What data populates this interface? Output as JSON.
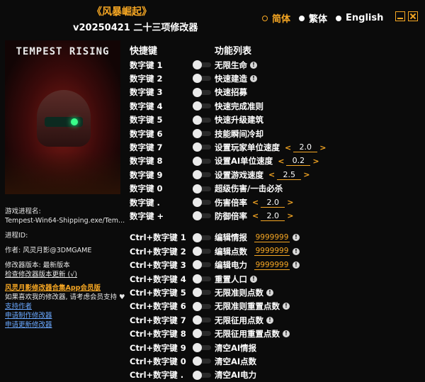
{
  "header": {
    "title": "《风暴崛起》",
    "version": "v20250421 二十三项修改器",
    "languages": [
      {
        "label": "简体",
        "selected": true
      },
      {
        "label": "繁体",
        "selected": false
      },
      {
        "label": "English",
        "selected": false
      }
    ]
  },
  "cover": {
    "logo_text": "TEMPEST RISING"
  },
  "info": {
    "process_label": "游戏进程名:",
    "process_value": "Tempest-Win64-Shipping.exe/Tem...",
    "pid_label": "进程ID:",
    "author": "作者: 风灵月影@3DMGAME",
    "trainer_version": "修改器版本: 最新版本",
    "check_update": "检查修改器版本更新 (√)",
    "app_link": "风灵月影修改器合集App会员版",
    "support_text": "如果喜欢我的修改器, 请考虑会员支持 ♥",
    "support_author": "支持作者",
    "request_trainer": "申请制作修改器",
    "request_update": "申请更新修改器"
  },
  "columns": {
    "hotkey": "快捷键",
    "features": "功能列表"
  },
  "rows_top": [
    {
      "key": "数字键 1",
      "label": "无限生命",
      "excl": true
    },
    {
      "key": "数字键 2",
      "label": "快速建造",
      "excl": true
    },
    {
      "key": "数字键 3",
      "label": "快速招募"
    },
    {
      "key": "数字键 4",
      "label": "快速完成准则"
    },
    {
      "key": "数字键 5",
      "label": "快速升级建筑"
    },
    {
      "key": "数字键 6",
      "label": "技能瞬间冷却"
    },
    {
      "key": "数字键 7",
      "label": "设置玩家单位速度",
      "stepper": "2.0"
    },
    {
      "key": "数字键 8",
      "label": "设置AI单位速度",
      "stepper": "0.2"
    },
    {
      "key": "数字键 9",
      "label": "设置游戏速度",
      "stepper": "2.5"
    },
    {
      "key": "数字键 0",
      "label": "超级伤害/一击必杀"
    },
    {
      "key": "数字键 .",
      "label": "伤害倍率",
      "stepper": "2.0"
    },
    {
      "key": "数字键 +",
      "label": "防御倍率",
      "stepper": "2.0"
    }
  ],
  "rows_bottom": [
    {
      "key": "Ctrl+数字键 1",
      "label": "编辑情报",
      "edit": "9999999",
      "excl": true
    },
    {
      "key": "Ctrl+数字键 2",
      "label": "编辑点数",
      "edit": "9999999",
      "excl": true
    },
    {
      "key": "Ctrl+数字键 3",
      "label": "编辑电力",
      "edit": "9999999",
      "excl": true
    },
    {
      "key": "Ctrl+数字键 4",
      "label": "重置人口",
      "excl": true
    },
    {
      "key": "Ctrl+数字键 5",
      "label": "无限准则点数",
      "excl": true
    },
    {
      "key": "Ctrl+数字键 6",
      "label": "无限准则重置点数",
      "excl": true
    },
    {
      "key": "Ctrl+数字键 7",
      "label": "无限征用点数",
      "excl": true
    },
    {
      "key": "Ctrl+数字键 8",
      "label": "无限征用重置点数",
      "excl": true
    },
    {
      "key": "Ctrl+数字键 9",
      "label": "清空AI情报"
    },
    {
      "key": "Ctrl+数字键 0",
      "label": "清空AI点数"
    },
    {
      "key": "Ctrl+数字键 .",
      "label": "清空AI电力"
    }
  ],
  "colors": {
    "accent": "#f5a623",
    "background": "#0b0b0b",
    "link_blue": "#6aa8ff"
  }
}
